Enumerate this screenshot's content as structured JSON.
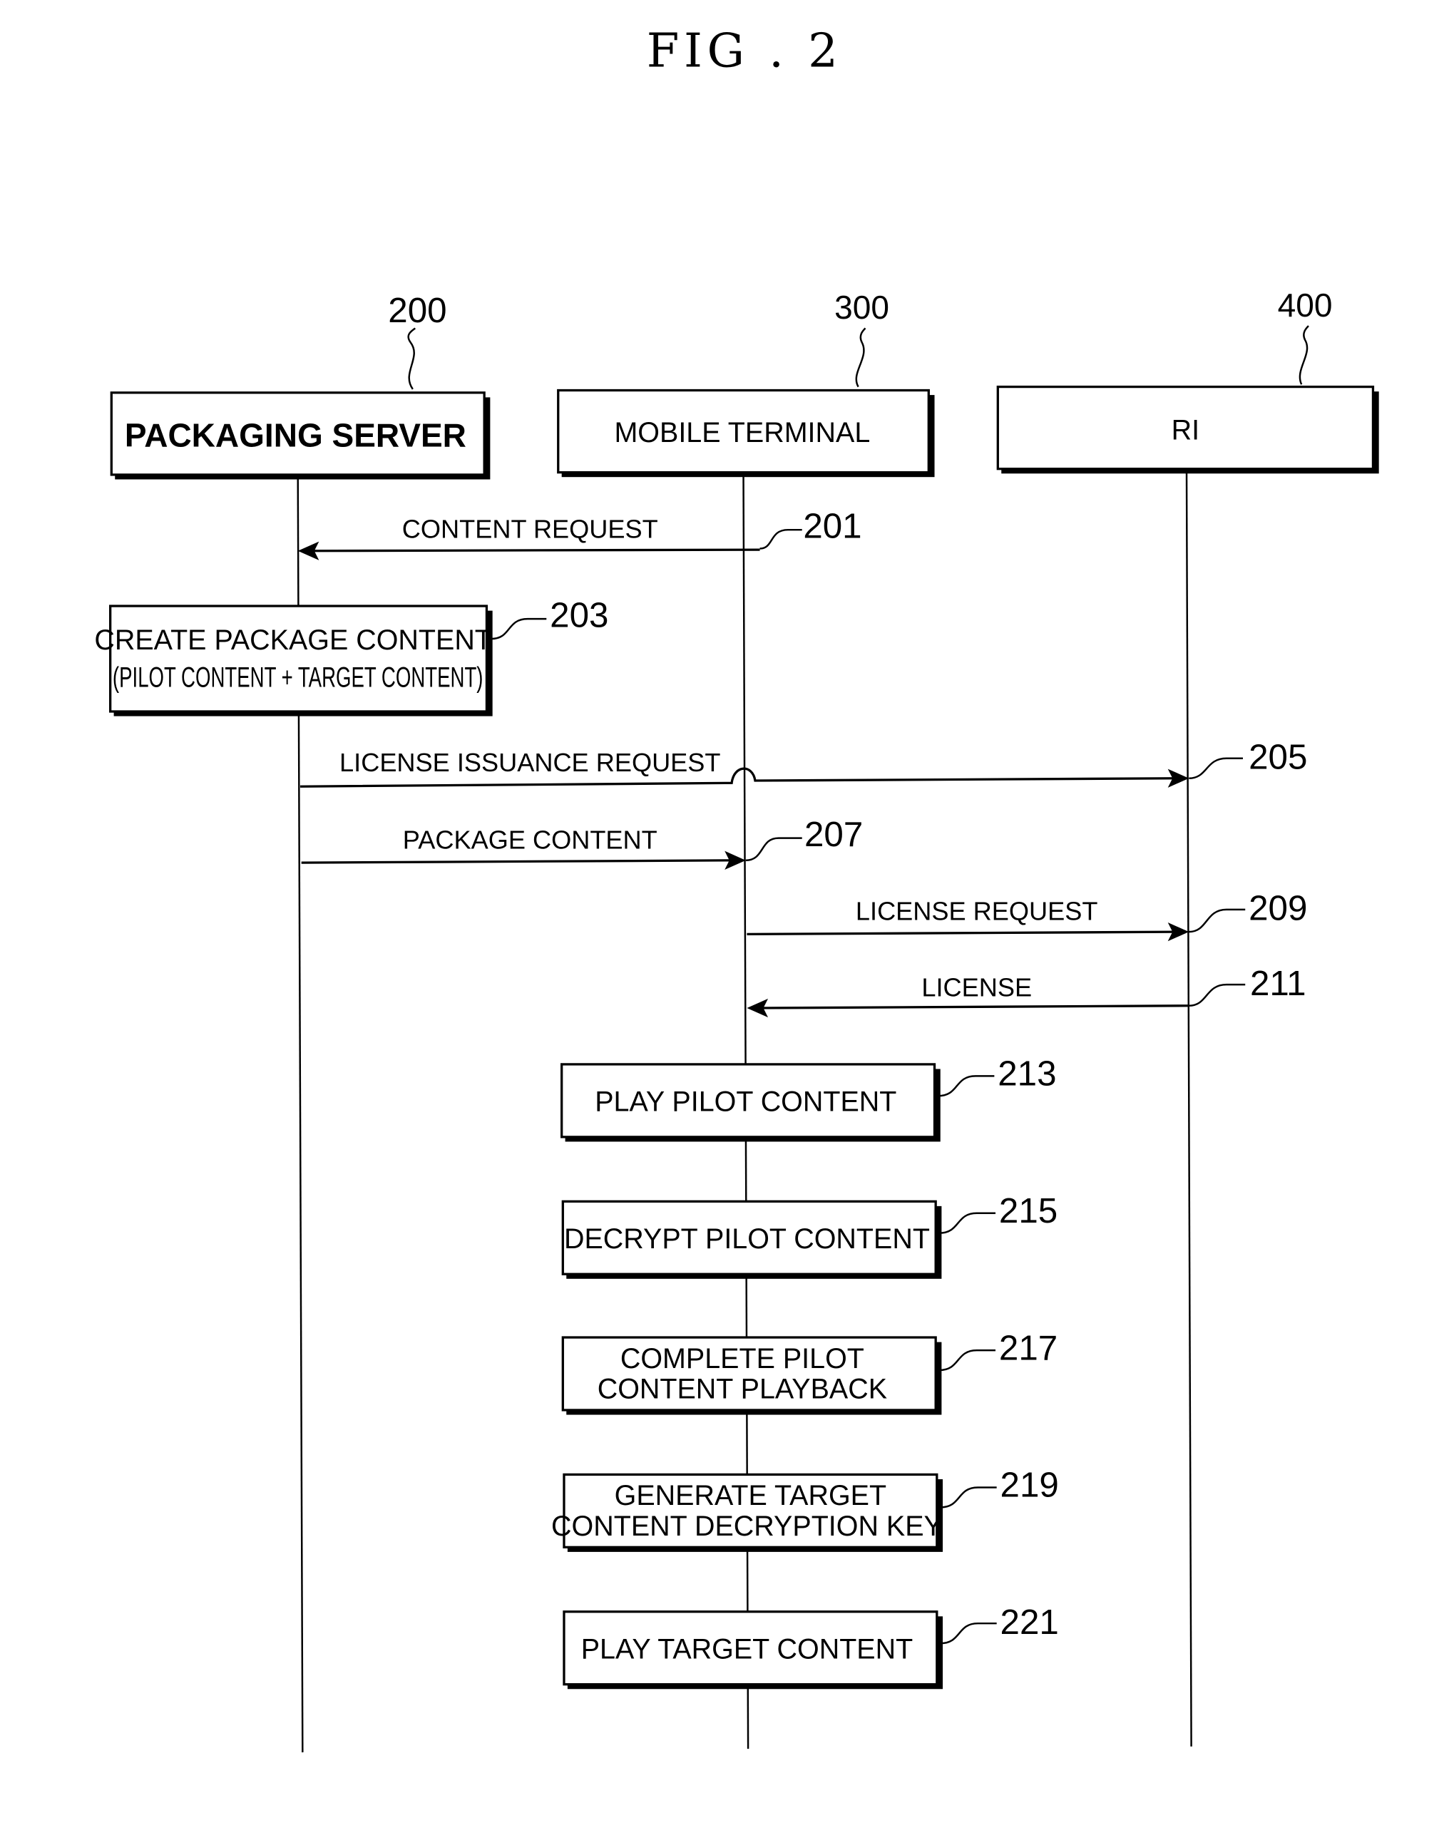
{
  "figure": {
    "title": "FIG . 2"
  },
  "entities": [
    {
      "ref": "200",
      "label": "PACKAGING SERVER"
    },
    {
      "ref": "300",
      "label": "MOBILE TERMINAL"
    },
    {
      "ref": "400",
      "label": "RI"
    }
  ],
  "messages": [
    {
      "ref": "201",
      "label": "CONTENT REQUEST",
      "from": "MOBILE TERMINAL",
      "to": "PACKAGING SERVER"
    },
    {
      "ref": "205",
      "label": "LICENSE ISSUANCE REQUEST",
      "from": "PACKAGING SERVER",
      "to": "RI"
    },
    {
      "ref": "207",
      "label": "PACKAGE CONTENT",
      "from": "PACKAGING SERVER",
      "to": "MOBILE TERMINAL"
    },
    {
      "ref": "209",
      "label": "LICENSE REQUEST",
      "from": "MOBILE TERMINAL",
      "to": "RI"
    },
    {
      "ref": "211",
      "label": "LICENSE",
      "from": "RI",
      "to": "MOBILE TERMINAL"
    }
  ],
  "steps": [
    {
      "ref": "203",
      "lines": [
        "CREATE PACKAGE CONTENT",
        "(PILOT CONTENT + TARGET CONTENT)"
      ]
    },
    {
      "ref": "213",
      "lines": [
        "PLAY PILOT CONTENT"
      ]
    },
    {
      "ref": "215",
      "lines": [
        "DECRYPT PILOT CONTENT"
      ]
    },
    {
      "ref": "217",
      "lines": [
        "COMPLETE PILOT",
        "CONTENT PLAYBACK"
      ]
    },
    {
      "ref": "219",
      "lines": [
        "GENERATE TARGET",
        "CONTENT DECRYPTION KEY"
      ]
    },
    {
      "ref": "221",
      "lines": [
        "PLAY TARGET CONTENT"
      ]
    }
  ]
}
